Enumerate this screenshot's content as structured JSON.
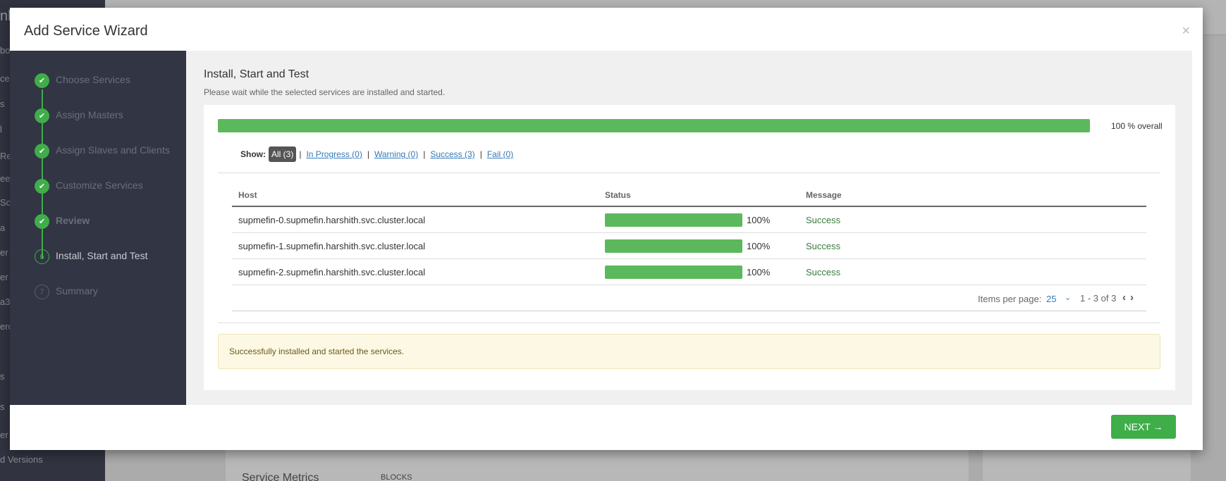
{
  "background": {
    "sidebar_fragments": [
      "nb",
      "bo",
      "ce",
      "s",
      "l",
      "Re",
      "ee",
      "Sc",
      "a",
      "er",
      "er",
      "a3",
      "erc",
      "s",
      "s",
      "er",
      "d Versions"
    ],
    "panel_title": "Service Metrics",
    "panel_sub": "BLOCKS"
  },
  "modal": {
    "title": "Add Service Wizard",
    "close_symbol": "×"
  },
  "steps": [
    {
      "label": "Choose Services",
      "marker": "✔",
      "state": "done"
    },
    {
      "label": "Assign Masters",
      "marker": "✔",
      "state": "done"
    },
    {
      "label": "Assign Slaves and Clients",
      "marker": "✔",
      "state": "done"
    },
    {
      "label": "Customize Services",
      "marker": "✔",
      "state": "done"
    },
    {
      "label": "Review",
      "marker": "✔",
      "state": "done"
    },
    {
      "label": "Install, Start and Test",
      "marker": "6",
      "state": "active"
    },
    {
      "label": "Summary",
      "marker": "7",
      "state": "todo"
    }
  ],
  "content": {
    "title": "Install, Start and Test",
    "subtitle": "Please wait while the selected services are installed and started.",
    "overall_progress": 100,
    "overall_label": "100 % overall",
    "filter": {
      "show_label": "Show:",
      "all": "All (3)",
      "in_progress": "In Progress (0)",
      "warning": "Warning (0)",
      "success": "Success (3)",
      "fail": "Fail (0)",
      "separator": "|"
    },
    "table": {
      "headers": {
        "host": "Host",
        "status": "Status",
        "message": "Message"
      },
      "rows": [
        {
          "host": "supmefin-0.supmefin.harshith.svc.cluster.local",
          "progress": 100,
          "pct": "100%",
          "message": "Success"
        },
        {
          "host": "supmefin-1.supmefin.harshith.svc.cluster.local",
          "progress": 100,
          "pct": "100%",
          "message": "Success"
        },
        {
          "host": "supmefin-2.supmefin.harshith.svc.cluster.local",
          "progress": 100,
          "pct": "100%",
          "message": "Success"
        }
      ]
    },
    "pager": {
      "label": "Items per page:",
      "count": "25",
      "range": "1 - 3 of 3"
    },
    "alert": "Successfully installed and started the services."
  },
  "footer": {
    "next_label": "NEXT →"
  },
  "colors": {
    "accent_green": "#3fae49",
    "progress_green": "#5cb85c",
    "nav_bg": "#323544",
    "link_blue": "#337ab7"
  }
}
